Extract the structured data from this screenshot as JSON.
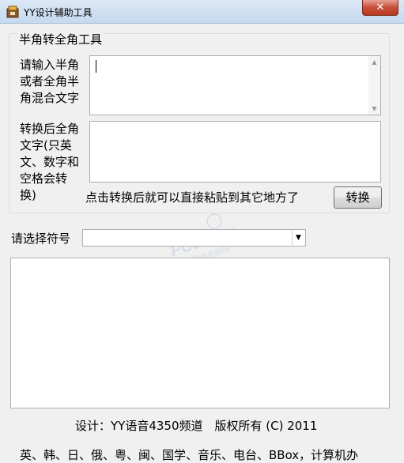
{
  "window": {
    "title": "YY设计辅助工具",
    "close_label": "✕"
  },
  "group": {
    "title": "半角转全角工具"
  },
  "input": {
    "label": "请输入半角\n或者全角半\n角混合文字",
    "value": ""
  },
  "output": {
    "label": "转换后全角\n文字(只英\n文、数字和\n空格会转\n换)",
    "value": ""
  },
  "hint": "点击转换后就可以直接粘贴到其它地方了",
  "convert_button": "转换",
  "symbol": {
    "label": "请选择符号",
    "selected": ""
  },
  "footer": "设计：YY语音4350频道　版权所有 (C) 2011",
  "bottom_text": "英、韩、日、俄、粤、闽、国学、音乐、电台、BBox，计算机办",
  "watermark": {
    "brand": "PConline",
    "sub": "太平洋电脑网"
  }
}
